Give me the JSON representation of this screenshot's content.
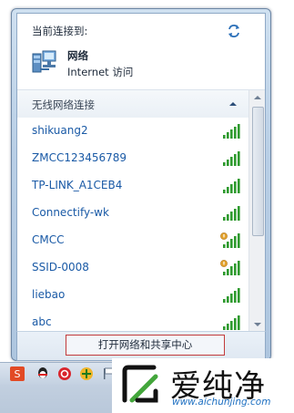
{
  "flyout": {
    "header_title": "当前连接到:",
    "connected_network": {
      "name": "网络",
      "status": "Internet 访问",
      "icon": "network-icon"
    },
    "refresh_icon": "refresh-icon"
  },
  "wireless": {
    "section_title": "无线网络连接",
    "collapse_icon": "chevron-up-icon",
    "networks": [
      {
        "ssid": "shikuang2",
        "signal": 5,
        "secured": false
      },
      {
        "ssid": "ZMCC123456789",
        "signal": 5,
        "secured": false
      },
      {
        "ssid": "TP-LINK_A1CEB4",
        "signal": 5,
        "secured": false
      },
      {
        "ssid": "Connectify-wk",
        "signal": 5,
        "secured": false
      },
      {
        "ssid": "CMCC",
        "signal": 5,
        "secured": true
      },
      {
        "ssid": "SSID-0008",
        "signal": 5,
        "secured": true
      },
      {
        "ssid": "liebao",
        "signal": 5,
        "secured": false
      },
      {
        "ssid": "abc",
        "signal": 5,
        "secured": false
      }
    ]
  },
  "footer": {
    "link_label": "打开网络和共享中心"
  },
  "watermark": {
    "brand": "爱纯净",
    "url": "www.aichunjing.com"
  },
  "colors": {
    "link": "#1a5aa6",
    "signal_green": "#2e9a2e",
    "highlight_border": "#c23b3b",
    "shield": "#e2a12b"
  }
}
